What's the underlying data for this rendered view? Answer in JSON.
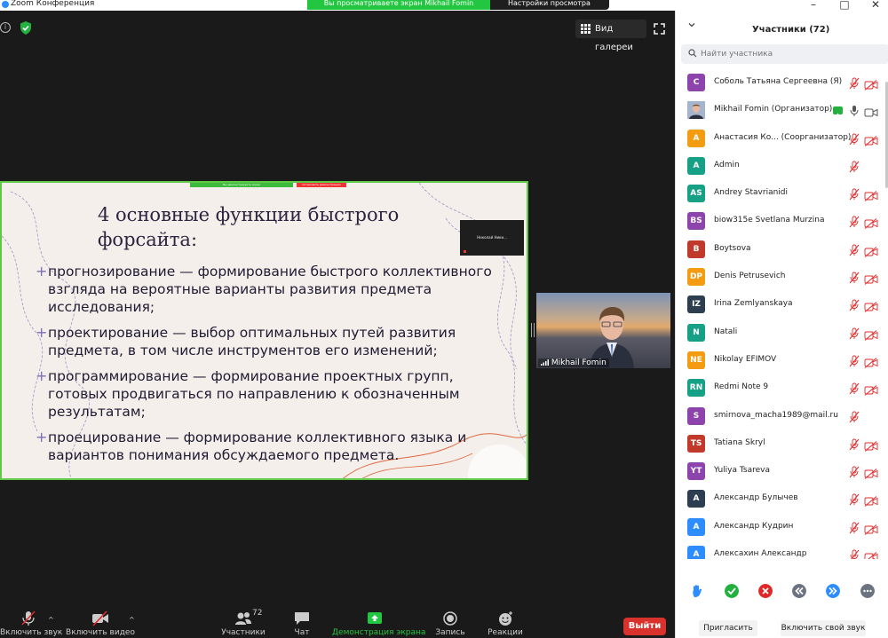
{
  "window": {
    "title": "Zoom Конференция",
    "share_banner": "Вы просматриваете экран Mikhail Fomin",
    "view_settings": "Настройки просмотра"
  },
  "meeting": {
    "gallery_label": "Вид галереи"
  },
  "slide": {
    "share_bar_text": "Вы демонстрируете экран",
    "stop_share_text": "Остановить демонстрацию",
    "title": "4 основные функции быстрого форсайта:",
    "bullets": [
      "прогнозирование — формирование быстрого коллективного взгляда на вероятные варианты развития предмета исследования;",
      "проектирование — выбор оптимальных путей развития предмета, в том числе инструментов его изменений;",
      "программирование — формирование проектных групп, готовых продвигаться по направлению к обозначенным результатам;",
      "проецирование — формирование коллективного языка и вариантов понимания обсуждаемого предмета."
    ],
    "mini_thumb_name": "Николай Ники..."
  },
  "video_tile": {
    "name": "Mikhail Fomin"
  },
  "toolbar": {
    "audio": "Включить звук",
    "video": "Включить видео",
    "participants": "Участники",
    "participants_count": "72",
    "chat": "Чат",
    "share": "Демонстрация экрана",
    "record": "Запись",
    "reactions": "Реакции",
    "leave": "Выйти"
  },
  "panel": {
    "title": "Участники (72)",
    "search_placeholder": "Найти участника",
    "participants": [
      {
        "initials": "С",
        "name": "Соболь Татьяна Сергеевна (Я)",
        "color": "#8e44ad",
        "mic": "muted",
        "cam": "off"
      },
      {
        "initials": "",
        "name": "Mikhail Fomin (Организатор)",
        "color": "#6b7a99",
        "photo": true,
        "sharing": true,
        "mic": "on",
        "cam": "on"
      },
      {
        "initials": "А",
        "name": "Анастасия Ко...  (Соорганизатор)",
        "color": "#f39c12",
        "mic": "muted",
        "cam": "off"
      },
      {
        "initials": "A",
        "name": "Admin",
        "color": "#16a085",
        "mic": "muted",
        "cam": "none"
      },
      {
        "initials": "AS",
        "name": "Andrey Stavrianidi",
        "color": "#16a085",
        "mic": "muted",
        "cam": "off"
      },
      {
        "initials": "BS",
        "name": "biow315e Svetlana Murzina",
        "color": "#8e44ad",
        "mic": "muted",
        "cam": "off"
      },
      {
        "initials": "B",
        "name": "Boytsova",
        "color": "#c0392b",
        "mic": "muted",
        "cam": "off"
      },
      {
        "initials": "DP",
        "name": "Denis Petrusevich",
        "color": "#f39c12",
        "mic": "muted",
        "cam": "off"
      },
      {
        "initials": "IZ",
        "name": "Irina Zemlyanskaya",
        "color": "#2c3e50",
        "mic": "muted",
        "cam": "off"
      },
      {
        "initials": "N",
        "name": "Natali",
        "color": "#16a085",
        "mic": "muted",
        "cam": "off"
      },
      {
        "initials": "NE",
        "name": "Nikolay EFIMOV",
        "color": "#f39c12",
        "mic": "muted",
        "cam": "off"
      },
      {
        "initials": "RN",
        "name": "Redmi Note 9",
        "color": "#16a085",
        "mic": "muted",
        "cam": "off"
      },
      {
        "initials": "S",
        "name": "smirnova_macha1989@mail.ru",
        "color": "#8e44ad",
        "mic": "muted",
        "cam": "none"
      },
      {
        "initials": "TS",
        "name": "Tatiana Skryl",
        "color": "#c0392b",
        "mic": "muted",
        "cam": "off"
      },
      {
        "initials": "YT",
        "name": "Yuliya Tsareva",
        "color": "#8e44ad",
        "mic": "muted",
        "cam": "off"
      },
      {
        "initials": "А",
        "name": "Александр Булычев",
        "color": "#2c3e50",
        "mic": "muted",
        "cam": "off"
      },
      {
        "initials": "А",
        "name": "Александр Кудрин",
        "color": "#2d8cff",
        "mic": "muted",
        "cam": "off"
      },
      {
        "initials": "А",
        "name": "Алексахин Александр",
        "color": "#2d8cff",
        "mic": "muted",
        "cam": "off"
      }
    ],
    "invite_label": "Пригласить",
    "unmute_label": "Включить свой звук"
  },
  "colors": {
    "zoom_blue": "#2d8cff",
    "share_green": "#23c640",
    "leave_red": "#d9312c",
    "muted_red": "#e02828"
  }
}
